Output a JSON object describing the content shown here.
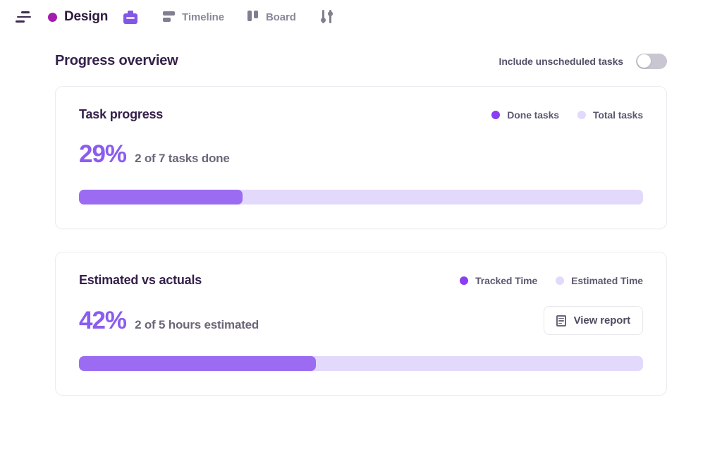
{
  "topbar": {
    "sort_icon": "sort-icon",
    "project": {
      "name": "Design",
      "dot_color": "#a41cae"
    },
    "briefcase_icon": "briefcase-icon",
    "tabs": [
      {
        "label": "Timeline",
        "icon": "timeline-icon"
      },
      {
        "label": "Board",
        "icon": "board-icon"
      }
    ],
    "settings_icon": "sliders-icon"
  },
  "section": {
    "title": "Progress overview",
    "toggle": {
      "label": "Include unscheduled tasks",
      "state": "off"
    }
  },
  "cards": [
    {
      "title": "Task progress",
      "legend": [
        {
          "label": "Done tasks",
          "color": "#8a3ef0"
        },
        {
          "label": "Total tasks",
          "color": "#e3d9fb"
        }
      ],
      "percent": "29%",
      "subtitle": "2 of 7 tasks done",
      "bar": {
        "fill_percent": 29,
        "fill_color": "#9b6cf2",
        "track_color": "#e3d9fb"
      }
    },
    {
      "title": "Estimated vs actuals",
      "legend": [
        {
          "label": "Tracked Time",
          "color": "#8a3ef0"
        },
        {
          "label": "Estimated Time",
          "color": "#e3d9fb"
        }
      ],
      "percent": "42%",
      "subtitle": "2 of 5 hours estimated",
      "action": {
        "label": "View report",
        "icon": "report-document-icon"
      },
      "bar": {
        "fill_percent": 42,
        "fill_color": "#9b6cf2",
        "track_color": "#e3d9fb"
      }
    }
  ]
}
